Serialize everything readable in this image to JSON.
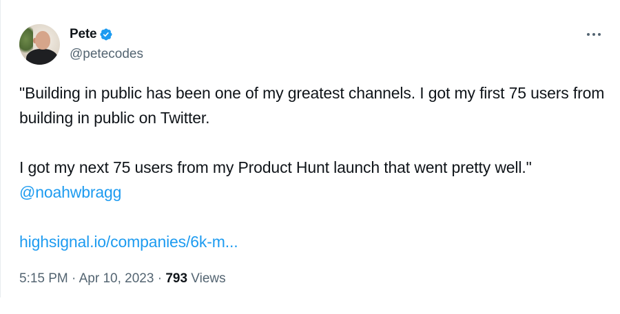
{
  "author": {
    "display_name": "Pete",
    "handle": "@petecodes",
    "verified": true
  },
  "menu": {
    "icon": "more-horizontal-icon"
  },
  "tweet": {
    "paragraph_1": "\"Building in public has been one of my greatest channels. I got my first 75 users from building in public on Twitter.",
    "paragraph_2": "I got my next 75 users from my Product Hunt launch that went pretty well.\"",
    "mention": "@noahwbragg",
    "link": "highsignal.io/companies/6k-m..."
  },
  "meta": {
    "time": "5:15 PM",
    "separator": "·",
    "date": "Apr 10, 2023",
    "views_count": "793",
    "views_label": "Views"
  },
  "colors": {
    "link": "#1d9bf0",
    "text": "#0f1419",
    "secondary": "#536471",
    "verified_badge": "#1d9bf0"
  }
}
